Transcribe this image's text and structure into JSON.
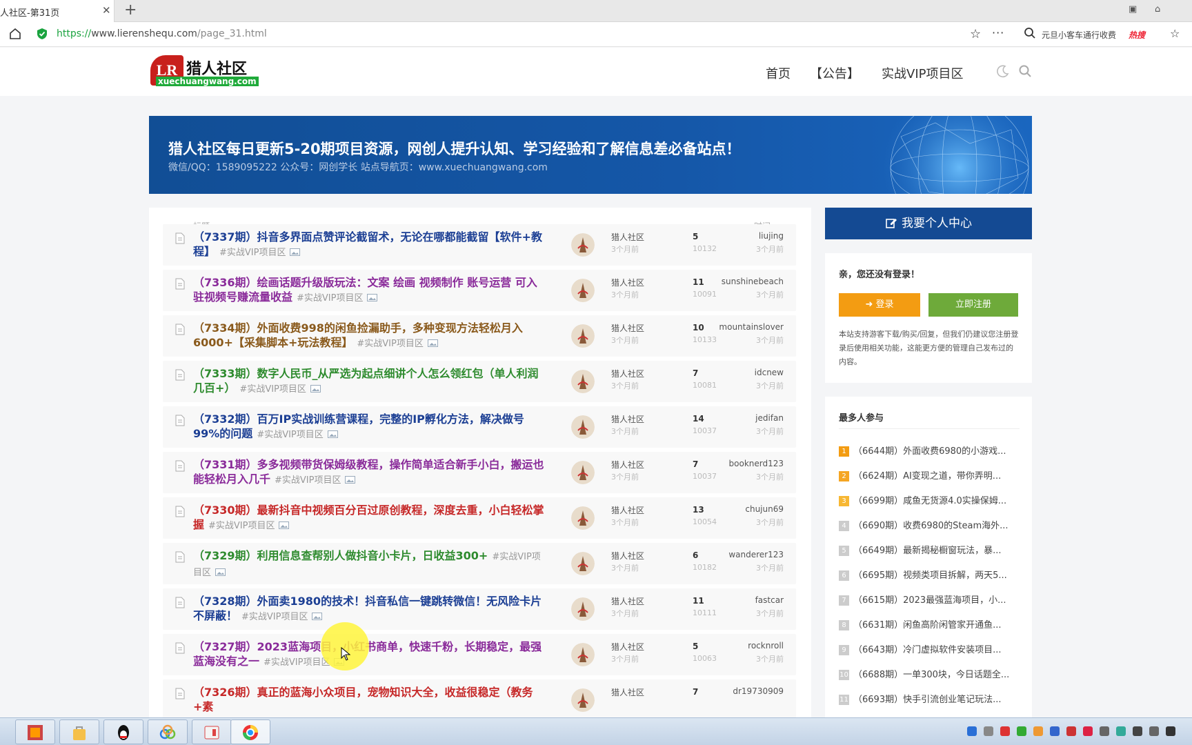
{
  "browser": {
    "tab_title": "人社区-第31页",
    "url_scheme": "https://",
    "url_host": "www.lierenshequ.com",
    "url_path": "/page_31.html",
    "hot_search": "元旦小客车通行收费",
    "hot_badge": "热搜"
  },
  "site": {
    "logo_mark": "LR",
    "logo_name": "猎人社区",
    "logo_domain": "xuechuangwang.com",
    "nav": [
      "首页",
      "【公告】",
      "实战VIP项目区"
    ]
  },
  "banner": {
    "headline": "猎人社区每日更新5-20期项目资源，网创人提升认知、学习经验和了解信息差必备站点！",
    "sub": "微信/QQ：1589095222 公众号：网创学长 站点导航页：www.xuechuangwang.com"
  },
  "list": {
    "col_title": "标题",
    "col_time": "时间",
    "rows": [
      {
        "title": "（7337期）抖音多界面点赞评论截留术，无论在哪都能截留【软件+教程】",
        "tag": "#实战VIP项目区",
        "color": "#1c3f94",
        "author": "猎人社区",
        "author_time": "3个月前",
        "replies": "5",
        "views": "10132",
        "last_user": "liujing",
        "last_time": "3个月前"
      },
      {
        "title": "（7336期）绘画话题升级版玩法：文案 绘画 视频制作 账号运营 可入驻视频号赚流量收益",
        "tag": "#实战VIP项目区",
        "color": "#8a2b9a",
        "author": "猎人社区",
        "author_time": "3个月前",
        "replies": "11",
        "views": "10091",
        "last_user": "sunshinebeach",
        "last_time": "3个月前"
      },
      {
        "title": "（7334期）外面收费998的闲鱼捡漏助手，多种变现方法轻松月入6000+【采集脚本+玩法教程】",
        "tag": "#实战VIP项目区",
        "color": "#8a5a1c",
        "author": "猎人社区",
        "author_time": "3个月前",
        "replies": "10",
        "views": "10133",
        "last_user": "mountainslover",
        "last_time": "3个月前"
      },
      {
        "title": "（7333期）数字人民币_从严选为起点细讲个人怎么领红包（单人利润几百+）",
        "tag": "#实战VIP项目区",
        "color": "#2e8b2e",
        "author": "猎人社区",
        "author_time": "3个月前",
        "replies": "7",
        "views": "10081",
        "last_user": "idcnew",
        "last_time": "3个月前"
      },
      {
        "title": "（7332期）百万IP实战训练营课程，完整的IP孵化方法，解决做号99%的问题",
        "tag": "#实战VIP项目区",
        "color": "#1c3f94",
        "author": "猎人社区",
        "author_time": "3个月前",
        "replies": "14",
        "views": "10037",
        "last_user": "jedifan",
        "last_time": "3个月前"
      },
      {
        "title": "（7331期）多多视频带货保姆级教程，操作简单适合新手小白，搬运也能轻松月入几千",
        "tag": "#实战VIP项目区",
        "color": "#8a2b9a",
        "author": "猎人社区",
        "author_time": "3个月前",
        "replies": "7",
        "views": "10037",
        "last_user": "booknerd123",
        "last_time": "3个月前"
      },
      {
        "title": "（7330期）最新抖音中视频百分百过原创教程，深度去重，小白轻松掌握",
        "tag": "#实战VIP项目区",
        "color": "#c62828",
        "author": "猎人社区",
        "author_time": "3个月前",
        "replies": "13",
        "views": "10054",
        "last_user": "chujun69",
        "last_time": "3个月前"
      },
      {
        "title": "（7329期）利用信息查帮别人做抖音小卡片，日收益300+",
        "tag": "#实战VIP项目区",
        "color": "#2e8b2e",
        "author": "猎人社区",
        "author_time": "3个月前",
        "replies": "6",
        "views": "10182",
        "last_user": "wanderer123",
        "last_time": "3个月前"
      },
      {
        "title": "（7328期）外面卖1980的技术！抖音私信一键跳转微信！无风险卡片不屏蔽！",
        "tag": "#实战VIP项目区",
        "color": "#1c3f94",
        "author": "猎人社区",
        "author_time": "3个月前",
        "replies": "11",
        "views": "10111",
        "last_user": "fastcar",
        "last_time": "3个月前"
      },
      {
        "title": "（7327期）2023蓝海项目，小红书商单，快速千粉，长期稳定，最强蓝海没有之一",
        "tag": "#实战VIP项目区",
        "color": "#8a2b9a",
        "author": "猎人社区",
        "author_time": "3个月前",
        "replies": "5",
        "views": "10063",
        "last_user": "rocknroll",
        "last_time": "3个月前"
      },
      {
        "title": "（7326期）真正的蓝海小众项目，宠物知识大全，收益很稳定（教务+素",
        "tag": "",
        "color": "#c62828",
        "author": "猎人社区",
        "author_time": "",
        "replies": "7",
        "views": "",
        "last_user": "dr19730909",
        "last_time": ""
      }
    ]
  },
  "sidebar": {
    "user_center": "我要个人中心",
    "login_title": "亲，您还没有登录！",
    "login_button": "登录",
    "register_button": "立即注册",
    "login_desc": "本站支持游客下载/购买/回复，但我们仍建议您注册登录后使用相关功能，这能更方便的管理自己发布过的内容。",
    "hot_title": "最多人参与",
    "hot_items": [
      {
        "rank": "1",
        "text": "（6644期）外面收费6980的小游戏..."
      },
      {
        "rank": "2",
        "text": "（6624期）AI变现之道，带你弄明..."
      },
      {
        "rank": "3",
        "text": "（6699期）咸鱼无货源4.0实操保姆..."
      },
      {
        "rank": "4",
        "text": "（6690期）收费6980的Steam海外..."
      },
      {
        "rank": "5",
        "text": "（6649期）最新揭秘橱窗玩法，暴..."
      },
      {
        "rank": "6",
        "text": "（6695期）视频类项目拆解，两天5..."
      },
      {
        "rank": "7",
        "text": "（6615期）2023最强蓝海项目，小..."
      },
      {
        "rank": "8",
        "text": "（6631期）闲鱼高阶闲管家开通鱼..."
      },
      {
        "rank": "9",
        "text": "（6643期）冷门虚拟软件安装项目..."
      },
      {
        "rank": "10",
        "text": "（6688期）一单300块，今日话题全..."
      },
      {
        "rank": "11",
        "text": "（6693期）快手引流创业笔记玩法..."
      }
    ]
  },
  "colors": {
    "brand_blue": "#144a93",
    "login_orange": "#f39c12",
    "register_green": "#6eaa3a"
  }
}
